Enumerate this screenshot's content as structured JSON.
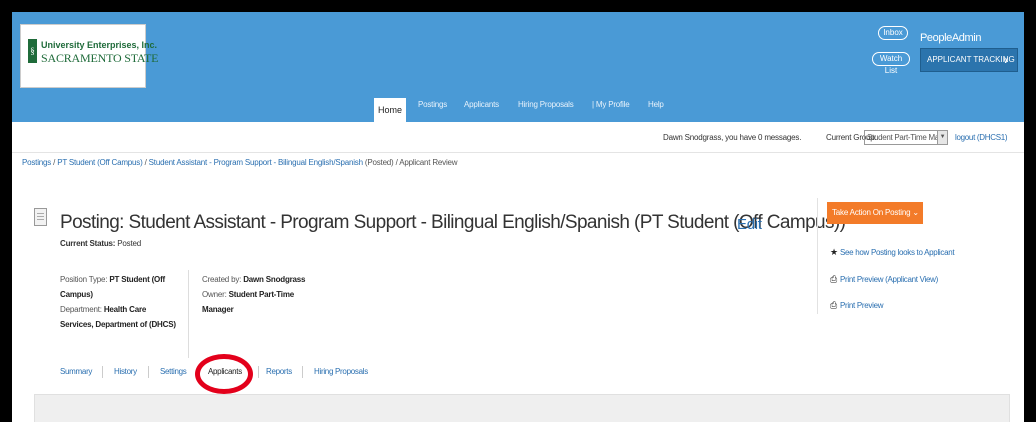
{
  "logo": {
    "line1": "University Enterprises, Inc.",
    "line2": "SACRAMENTO STATE"
  },
  "header": {
    "inbox": "Inbox",
    "watch_list": "Watch List",
    "brand": "PeopleAdmin",
    "app_switch": "APPLICANT TRACKING"
  },
  "nav": {
    "items": [
      "Home",
      "Postings",
      "Applicants",
      "Hiring Proposals",
      "| My Profile",
      "Help"
    ]
  },
  "messages": {
    "text": "Dawn Snodgrass, you have 0 messages.",
    "group_label": "Current Group:",
    "group_value": "Student Part-Time Manager",
    "logout": "logout (DHCS1)"
  },
  "breadcrumb": {
    "root": "Postings",
    "sep": "/",
    "crumb1": "PT Student (Off Campus)",
    "crumb2": "Student Assistant - Program Support - Bilingual English/Spanish",
    "state": "(Posted)",
    "current": "Applicant Review"
  },
  "posting": {
    "title": "Posting: Student Assistant - Program Support - Bilingual English/Spanish (PT Student (Off Campus))",
    "edit": "Edit",
    "status_label": "Current Status:",
    "status_value": "Posted",
    "position_type_label": "Position Type:",
    "position_type_value": "PT Student (Off Campus)",
    "department_label": "Department:",
    "department_value": "Health Care Services, Department of (DHCS)",
    "created_by_label": "Created by:",
    "created_by_value": "Dawn Snodgrass",
    "owner_label": "Owner:",
    "owner_value": "Student Part-Time Manager"
  },
  "actions": {
    "take_action": "Take Action On Posting",
    "links": [
      "See how Posting looks to Applicant",
      "Print Preview (Applicant View)",
      "Print Preview"
    ]
  },
  "tabs": [
    "Summary",
    "History",
    "Settings",
    "Applicants",
    "Reports",
    "Hiring Proposals"
  ],
  "colors": {
    "header_blue": "#4a9ad6",
    "accent_orange": "#f37b29",
    "highlight_red": "#e3001b",
    "link_blue": "#2a6fb0"
  }
}
